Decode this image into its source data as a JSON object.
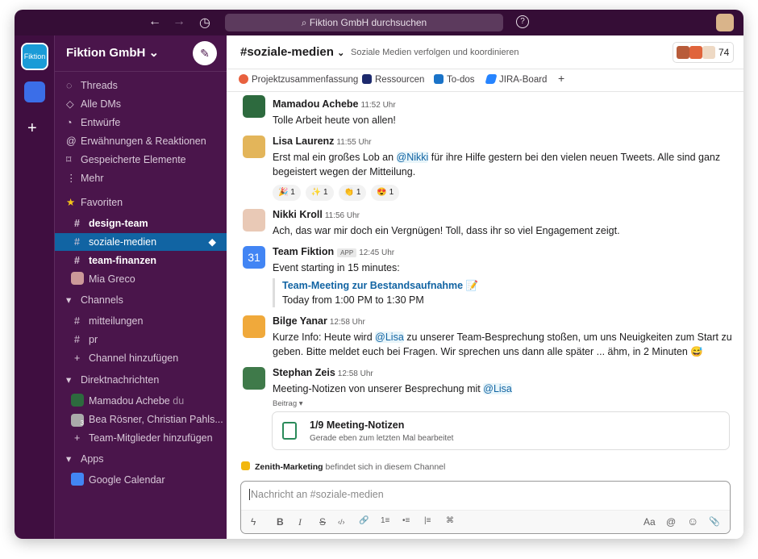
{
  "titlebar": {
    "search_placeholder": "Fiktion GmbH durchsuchen",
    "back": "←",
    "forward": "→",
    "history": "◷",
    "help": "?"
  },
  "rail": {
    "workspace_label": "Fiktion",
    "add": "+"
  },
  "sidebar": {
    "workspace": "Fiktion GmbH ⌄",
    "compose": "✎",
    "nav": [
      {
        "icon": "◌",
        "label": "Threads"
      },
      {
        "icon": "◇",
        "label": "Alle DMs"
      },
      {
        "icon": "◔",
        "label": "Entwürfe"
      },
      {
        "icon": "@",
        "label": "Erwähnungen & Reaktionen"
      },
      {
        "icon": "⌑",
        "label": "Gespeicherte Elemente"
      },
      {
        "icon": "⋮",
        "label": "Mehr"
      }
    ],
    "favorites_header": "Favoriten",
    "star": "★",
    "favorites": [
      {
        "icon": "#",
        "label": "design-team"
      },
      {
        "icon": "#",
        "label": "soziale-medien"
      },
      {
        "icon": "#",
        "label": "team-finanzen"
      },
      {
        "icon": "",
        "label": "Mia Greco"
      }
    ],
    "channels_header": "Channels",
    "channels": [
      {
        "icon": "#",
        "label": "mitteilungen"
      },
      {
        "icon": "#",
        "label": "pr"
      },
      {
        "icon": "+",
        "label": "Channel hinzufügen"
      }
    ],
    "dm_header": "Direktnachrichten",
    "dms": [
      {
        "label": "Mamadou Achebe",
        "suffix": "du"
      },
      {
        "label": "Bea Rösner, Christian Pahls...",
        "badge": "3"
      },
      {
        "icon": "+",
        "label": "Team-Mitglieder hinzufügen"
      }
    ],
    "apps_header": "Apps",
    "apps": [
      {
        "label": "Google Calendar"
      }
    ],
    "caret": "▾"
  },
  "channel": {
    "name": "#soziale-medien",
    "caret": "⌄",
    "description": "Soziale Medien verfolgen und koordinieren",
    "member_count": "74",
    "bookmarks": [
      {
        "label": "Projektzusammenfassung",
        "color": "#e8613f"
      },
      {
        "label": "Ressourcen",
        "color": "#1d2a6d"
      },
      {
        "label": "To-dos",
        "color": "#1a73c8"
      },
      {
        "label": "JIRA-Board",
        "color": "#2684ff"
      }
    ],
    "add_bookmark": "+"
  },
  "messages": [
    {
      "name": "Mamadou Achebe",
      "time": "11:52 Uhr",
      "text": "Tolle Arbeit heute von allen!",
      "avatar": "#2d6a3e"
    },
    {
      "name": "Lisa Laurenz",
      "time": "11:55 Uhr",
      "pre": "Erst mal ein großes Lob an ",
      "mention": "@Nikki",
      "post": " für ihre Hilfe gestern bei den vielen neuen Tweets. Alle sind ganz begeistert wegen der Mitteilung.",
      "avatar": "#e3b55a",
      "reactions": [
        {
          "emoji": "🎉",
          "count": "1"
        },
        {
          "emoji": "✨",
          "count": "1"
        },
        {
          "emoji": "👏",
          "count": "1"
        },
        {
          "emoji": "😍",
          "count": "1"
        }
      ]
    },
    {
      "name": "Nikki Kroll",
      "time": "11:56 Uhr",
      "text": "Ach, das war mir doch ein Vergnügen! Toll, dass ihr so viel Engagement zeigt.",
      "avatar": "#e9c9b6"
    },
    {
      "name": "Team Fiktion",
      "badge": "APP",
      "time": "12:45 Uhr",
      "text": "Event starting in 15 minutes:",
      "avatar_label": "31",
      "event_title": "Team-Meeting zur Bestandsaufnahme 📝",
      "event_time": "Today from 1:00 PM to 1:30 PM"
    },
    {
      "name": "Bilge Yanar",
      "time": "12:58 Uhr",
      "pre": "Kurze Info: Heute wird ",
      "mention": "@Lisa",
      "post": " zu unserer Team-Besprechung stoßen, um uns Neuigkeiten zum Start zu geben. Bitte meldet euch bei Fragen. Wir sprechen uns dann alle später ... ähm, in 2 Minuten 😅",
      "avatar": "#f0a93b"
    },
    {
      "name": "Stephan Zeis",
      "time": "12:58 Uhr",
      "pre": "Meeting-Notizen von unserer Besprechung mit ",
      "mention": "@Lisa",
      "post": "",
      "avatar": "#3f7a4a",
      "thread_label": "Beitrag ▾"
    }
  ],
  "file": {
    "title": "1/9 Meeting-Notizen",
    "subtitle": "Gerade eben zum letzten Mal bearbeitet"
  },
  "notice": {
    "name": "Zenith-Marketing",
    "text": " befindet sich in diesem Channel"
  },
  "composer": {
    "placeholder": "Nachricht an #soziale-medien",
    "tools": [
      "ϟ",
      "B",
      "I",
      "S",
      "‹/›",
      "🔗",
      "1≡",
      "•≡",
      "|≡",
      "⌘"
    ],
    "right_tools": [
      "Aa",
      "@",
      "☺",
      "📎"
    ]
  }
}
